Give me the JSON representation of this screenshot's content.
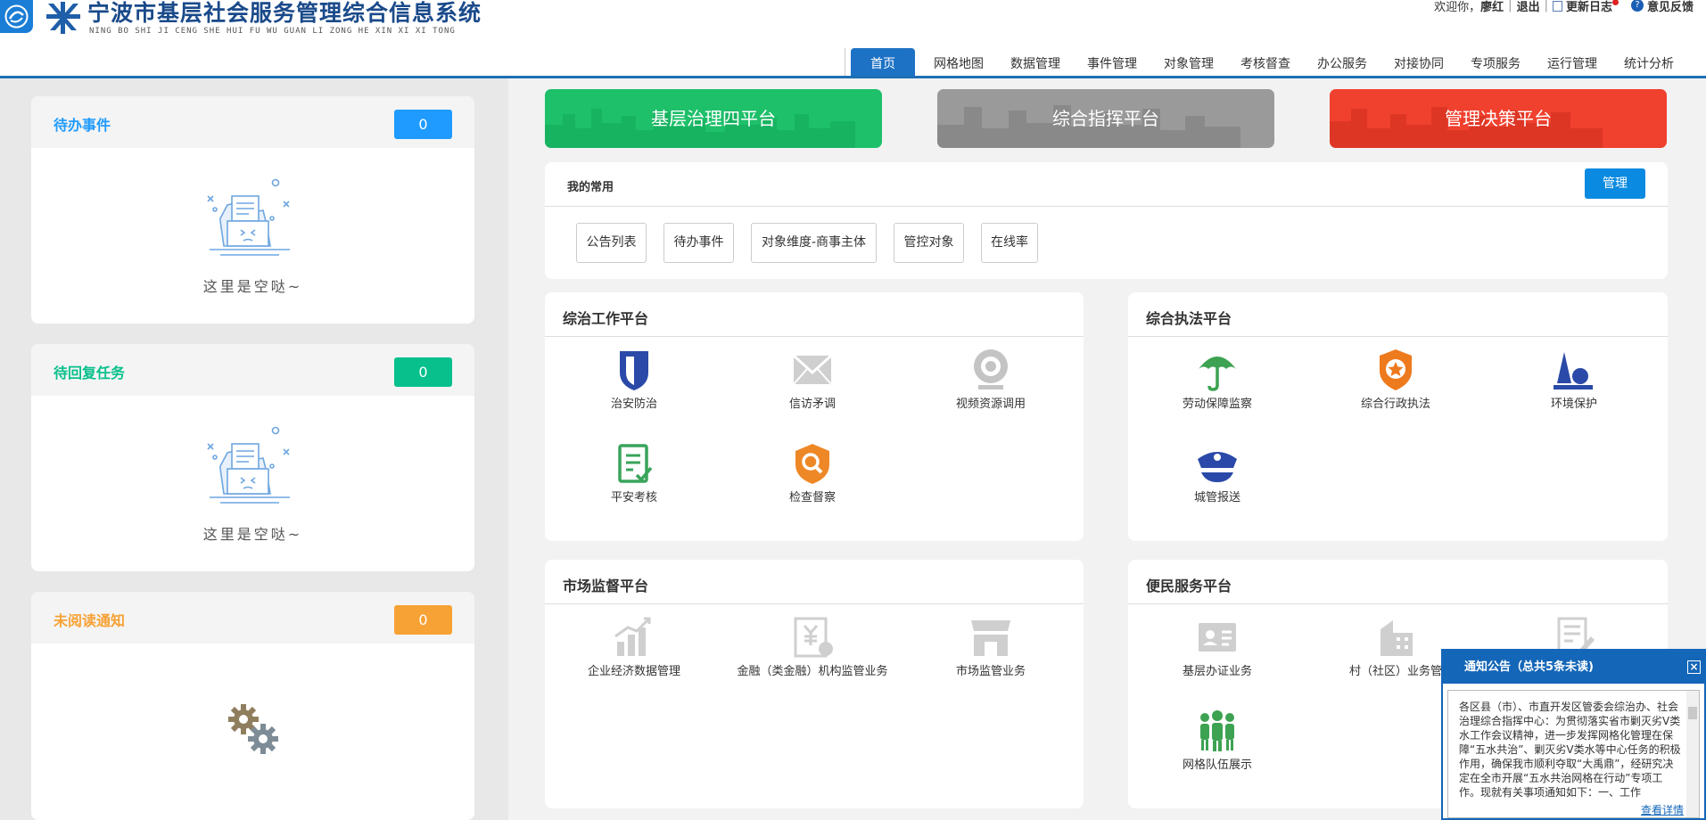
{
  "header": {
    "title": "宁波市基层社会服务管理综合信息系统",
    "subtitle": "NING BO SHI JI CENG SHE HUI FU WU GUAN LI ZONG HE XIN XI XI TONG",
    "welcome": "欢迎你，",
    "user": "廖红",
    "logout": "退出",
    "changelog": "更新日志",
    "feedback": "意见反馈"
  },
  "nav": {
    "tabs": [
      "首页",
      "网格地图",
      "数据管理",
      "事件管理",
      "对象管理",
      "考核督查",
      "办公服务",
      "对接协同",
      "专项服务",
      "运行管理",
      "统计分析"
    ]
  },
  "left": {
    "todo": {
      "title": "待办事件",
      "count": "0",
      "empty": "这里是空哒~",
      "color": "#1f9bff"
    },
    "reply": {
      "title": "待回复任务",
      "count": "0",
      "empty": "这里是空哒~",
      "color": "#08c08b"
    },
    "unread": {
      "title": "未阅读通知",
      "count": "0",
      "color": "#f7a235"
    }
  },
  "platforms": [
    {
      "label": "基层治理四平台",
      "color": "#1ec06a"
    },
    {
      "label": "综合指挥平台",
      "color": "#9a9a9a"
    },
    {
      "label": "管理决策平台",
      "color": "#f0402e"
    }
  ],
  "favorites": {
    "title": "我的常用",
    "manage": "管理",
    "items": [
      "公告列表",
      "待办事件",
      "对象维度-商事主体",
      "管控对象",
      "在线率"
    ]
  },
  "zongzhi": {
    "title": "综治工作平台",
    "items": [
      "治安防治",
      "信访矛调",
      "视频资源调用",
      "平安考核",
      "检查督察"
    ]
  },
  "zhifa": {
    "title": "综合执法平台",
    "items": [
      "劳动保障监察",
      "综合行政执法",
      "环境保护",
      "城管报送"
    ]
  },
  "market": {
    "title": "市场监督平台",
    "items": [
      "企业经济数据管理",
      "金融（类金融）机构监管业务",
      "市场监管业务"
    ]
  },
  "service": {
    "title": "便民服务平台",
    "items": [
      "基层办证业务",
      "村（社区）业务管",
      "网格队伍展示"
    ]
  },
  "notice": {
    "title": "通知公告（总共5条未读)",
    "body": "各区县（市）、市直开发区管委会综治办、社会治理综合指挥中心：为贯彻落实省市剿灭劣V类水工作会议精神，进一步发挥网格化管理在保障“五水共治”、剿灭劣V类水等中心任务的积极作用，确保我市顺利夺取“大禹鼎”，经研究决定在全市开展“五水共治网格在行动”专项工作。现就有关事项通知如下：一、工作",
    "more": "查看详情"
  }
}
